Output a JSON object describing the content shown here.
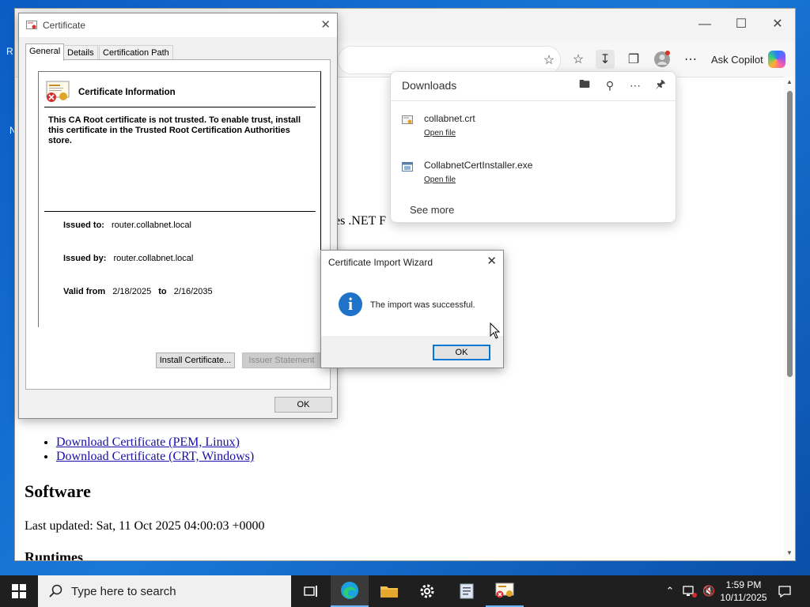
{
  "desktop": {
    "frag_r": "R",
    "frag_n": "N"
  },
  "browser": {
    "toolbar": {
      "ask_copilot_label": "Ask Copilot"
    },
    "page": {
      "partial_text": "es .NET F",
      "download_links": [
        "Download Certificate (PEM, Linux)",
        "Download Certificate (CRT, Windows)"
      ],
      "software_heading": "Software",
      "last_updated": "Last updated: Sat, 11 Oct 2025 04:00:03 +0000",
      "runtimes_heading": "Runtimes"
    }
  },
  "downloads_panel": {
    "title": "Downloads",
    "items": [
      {
        "name": "collabnet.crt",
        "action": "Open file",
        "icon": "certificate-file-icon"
      },
      {
        "name": "CollabnetCertInstaller.exe",
        "action": "Open file",
        "icon": "exe-file-icon"
      }
    ],
    "see_more": "See more"
  },
  "certificate_dialog": {
    "title": "Certificate",
    "tabs": [
      "General",
      "Details",
      "Certification Path"
    ],
    "active_tab": "General",
    "info_heading": "Certificate Information",
    "warning": "This CA Root certificate is not trusted. To enable trust, install this certificate in the Trusted Root Certification Authorities store.",
    "issued_to_label": "Issued to:",
    "issued_to": "router.collabnet.local",
    "issued_by_label": "Issued by:",
    "issued_by": "router.collabnet.local",
    "valid_from_label": "Valid from",
    "valid_from": "2/18/2025",
    "valid_to_label": "to",
    "valid_to": "2/16/2035",
    "install_button": "Install Certificate...",
    "issuer_statement_button": "Issuer Statement",
    "ok_button": "OK"
  },
  "import_wizard": {
    "title": "Certificate Import Wizard",
    "message": "The import was successful.",
    "ok_button": "OK"
  },
  "taskbar": {
    "search_placeholder": "Type here to search",
    "time": "1:59 PM",
    "date": "10/11/2025"
  },
  "colors": {
    "accent": "#0078d7",
    "taskbar": "#1f1f1f",
    "link": "#1a0dab"
  }
}
